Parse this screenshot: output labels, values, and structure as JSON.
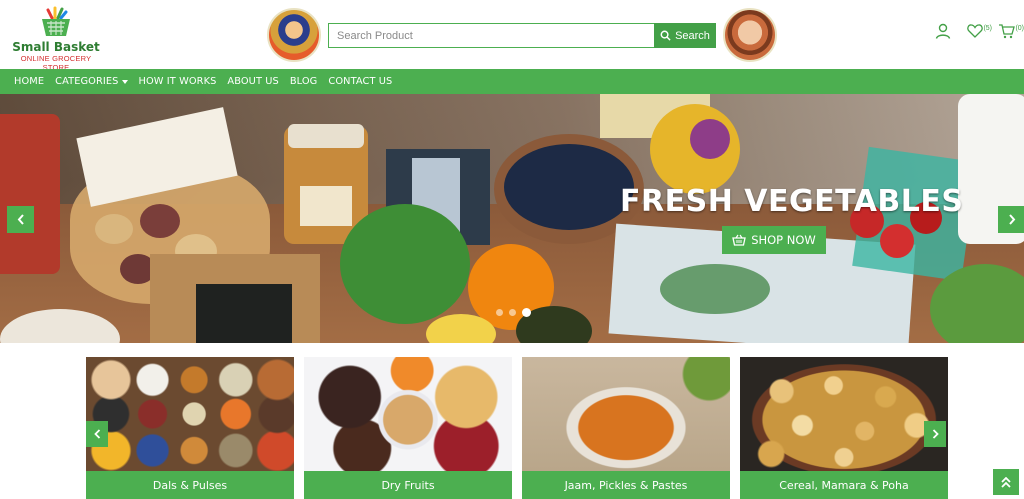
{
  "brand": {
    "name": "Small Basket",
    "tagline": "ONLINE GROCERY STORE"
  },
  "search": {
    "placeholder": "Search Product",
    "button_label": "Search"
  },
  "header_icons": {
    "wishlist_count": "(5)",
    "cart_count": "(0)"
  },
  "nav": {
    "items": [
      {
        "label": "HOME"
      },
      {
        "label": "CATEGORIES",
        "has_dropdown": true
      },
      {
        "label": "HOW IT WORKS"
      },
      {
        "label": "ABOUT US"
      },
      {
        "label": "BLOG"
      },
      {
        "label": "CONTACT US"
      }
    ]
  },
  "hero": {
    "title": "FRESH VEGETABLES",
    "cta_label": "SHOP NOW",
    "slide_count": 3,
    "active_slide": 3
  },
  "categories": [
    {
      "label": "Dals & Pulses"
    },
    {
      "label": "Dry Fruits"
    },
    {
      "label": "Jaam, Pickles & Pastes"
    },
    {
      "label": "Cereal, Mamara & Poha"
    }
  ],
  "colors": {
    "brand_green": "#4caf50",
    "accent_red": "#d32f2f"
  }
}
